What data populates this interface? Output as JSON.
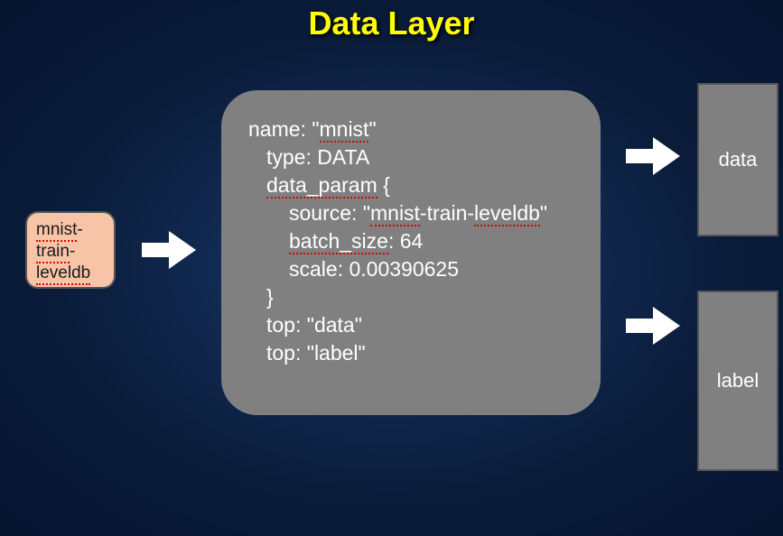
{
  "title": "Data Layer",
  "input": {
    "line1": "mnist",
    "line2": "train",
    "line3": "leveldb"
  },
  "config": {
    "name_key": "name",
    "name_val": "mnist",
    "type_key": "type",
    "type_val": "DATA",
    "data_param_key": "data_param",
    "brace_open": "{",
    "source_key": "source",
    "source_val_p1": "mnist",
    "source_val_p2": "-train-",
    "source_val_p3": "leveldb",
    "batch_size_key": "batch_size",
    "batch_size_val": "64",
    "scale_key": "scale",
    "scale_val": "0.00390625",
    "brace_close": "}",
    "top_key": "top",
    "top1_val": "data",
    "top2_val": "label"
  },
  "outputs": {
    "data": "data",
    "label": "label"
  }
}
